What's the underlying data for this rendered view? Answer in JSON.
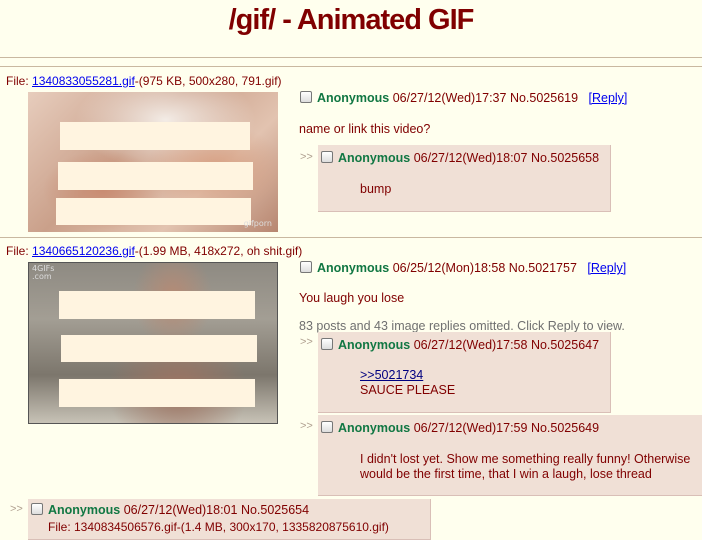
{
  "board": {
    "title": "/gif/ - Animated GIF"
  },
  "threads": [
    {
      "file": {
        "prefix": "File: ",
        "name": "1340833055281.gif",
        "info": "-(975 KB, 500x280, 791.gif)"
      },
      "thumb_watermark": "gifporn",
      "op": {
        "name": "Anonymous",
        "datetime": "06/27/12(Wed)17:37",
        "no": "No.5025619",
        "reply_label": "[Reply]",
        "message": "name or link this video?"
      },
      "replies": [
        {
          "arrows": ">>",
          "name": "Anonymous",
          "datetime": "06/27/12(Wed)18:07",
          "no": "No.5025658",
          "message": "bump"
        }
      ]
    },
    {
      "file": {
        "prefix": "File: ",
        "name": "1340665120236.gif",
        "info": "-(1.99 MB, 418x272, oh shit.gif)"
      },
      "thumb_watermark": "4GIFs .com",
      "op": {
        "name": "Anonymous",
        "datetime": "06/25/12(Mon)18:58",
        "no": "No.5021757",
        "reply_label": "[Reply]",
        "message": "You laugh you lose",
        "omitted": "83 posts and 43 image replies omitted. Click Reply to view."
      },
      "replies": [
        {
          "arrows": ">>",
          "name": "Anonymous",
          "datetime": "06/27/12(Wed)17:58",
          "no": "No.5025647",
          "quote": ">>5021734",
          "message": "SAUCE PLEASE"
        },
        {
          "arrows": ">>",
          "name": "Anonymous",
          "datetime": "06/27/12(Wed)17:59",
          "no": "No.5025649",
          "message_line1": "I didn't lost yet. Show me something really funny! Otherwise",
          "message_line2": "would be the first time, that I win a laugh, lose thread"
        },
        {
          "arrows": ">>",
          "name": "Anonymous",
          "datetime": "06/27/12(Wed)18:01",
          "no": "No.5025654",
          "file_partial": "File: 1340834506576.gif-(1.4 MB, 300x170, 1335820875610.gif)"
        }
      ]
    }
  ]
}
